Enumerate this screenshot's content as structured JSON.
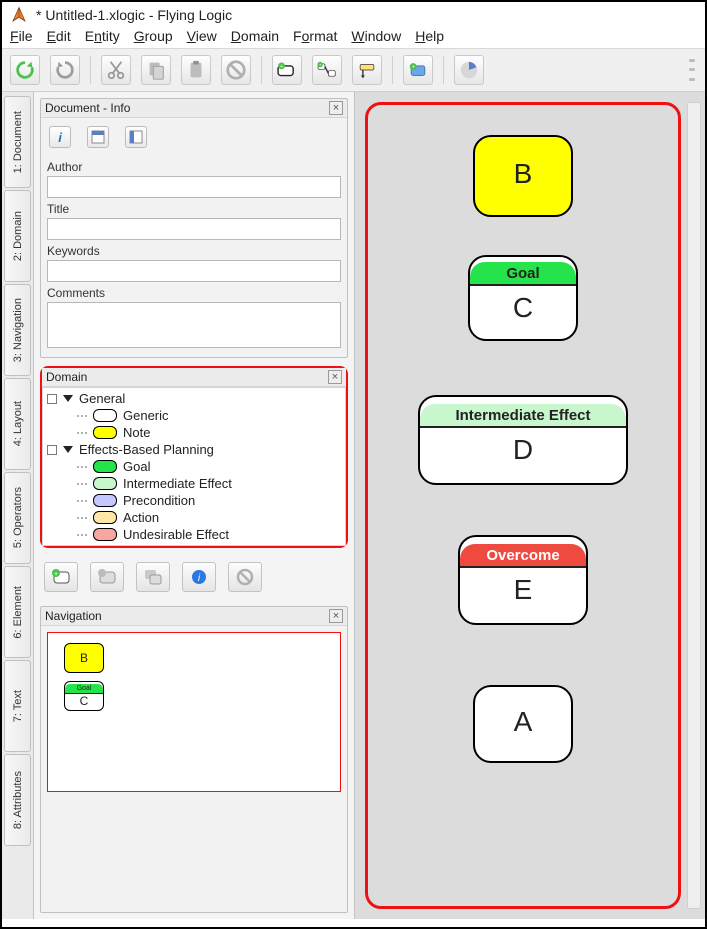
{
  "window": {
    "title": "* Untitled-1.xlogic - Flying Logic"
  },
  "menu": {
    "file": {
      "label": "File",
      "underline": "F"
    },
    "edit": {
      "label": "Edit",
      "underline": "E"
    },
    "entity": {
      "label": "Entity",
      "underline": "n"
    },
    "group": {
      "label": "Group",
      "underline": "G"
    },
    "view": {
      "label": "View",
      "underline": "V"
    },
    "domain": {
      "label": "Domain",
      "underline": "D"
    },
    "format": {
      "label": "Format",
      "underline": "o"
    },
    "window": {
      "label": "Window",
      "underline": "W"
    },
    "help": {
      "label": "Help",
      "underline": "H"
    }
  },
  "toolbar_icons": {
    "refresh": "refresh-icon",
    "redo": "redo-icon",
    "cut": "scissors-icon",
    "copy": "copy-icon",
    "paste": "clipboard-icon",
    "noentry": "noentry-icon",
    "addEntity": "add-entity-icon",
    "addEdge": "add-edge-icon",
    "addAnnotation": "add-annotation-icon",
    "addDomain": "add-domain-icon",
    "pie": "pie-icon"
  },
  "vtabs": [
    {
      "id": "document",
      "label": "1: Document"
    },
    {
      "id": "domain",
      "label": "2: Domain"
    },
    {
      "id": "navigation",
      "label": "3: Navigation"
    },
    {
      "id": "layout",
      "label": "4: Layout"
    },
    {
      "id": "operators",
      "label": "5: Operators"
    },
    {
      "id": "element",
      "label": "6: Element"
    },
    {
      "id": "text",
      "label": "7: Text"
    },
    {
      "id": "attributes",
      "label": "8: Attributes"
    }
  ],
  "docinfo": {
    "title": "Document - Info",
    "tabs": {
      "info": "info-tab-icon",
      "page1": "page-tab-icon",
      "page2": "page-tab-icon"
    },
    "fields": {
      "author": {
        "label": "Author",
        "value": ""
      },
      "title": {
        "label": "Title",
        "value": ""
      },
      "keywords": {
        "label": "Keywords",
        "value": ""
      },
      "comments": {
        "label": "Comments",
        "value": ""
      }
    }
  },
  "domain": {
    "title": "Domain",
    "groups": [
      {
        "name": "General",
        "items": [
          {
            "label": "Generic",
            "color": "#ffffff"
          },
          {
            "label": "Note",
            "color": "#ffff00"
          }
        ]
      },
      {
        "name": "Effects-Based Planning",
        "items": [
          {
            "label": "Goal",
            "color": "#25e34a"
          },
          {
            "label": "Intermediate Effect",
            "color": "#c8f7ce"
          },
          {
            "label": "Precondition",
            "color": "#c4c8ff"
          },
          {
            "label": "Action",
            "color": "#ffe8a6"
          },
          {
            "label": "Undesirable Effect",
            "color": "#f7a6a0"
          }
        ]
      }
    ],
    "buttons": {
      "add": "add-class-icon",
      "remove": "remove-class-icon",
      "dup": "duplicate-icon",
      "info": "info-icon",
      "noentry": "noentry-icon"
    }
  },
  "navigation": {
    "title": "Navigation",
    "mini": [
      {
        "label": "B",
        "hdr": "",
        "bg": "#ffff00"
      },
      {
        "label": "C",
        "hdr": "Goal",
        "hdrbg": "#25e34a",
        "bg": "#ffffff"
      }
    ]
  },
  "canvas": {
    "nodes": {
      "B": {
        "label": "B"
      },
      "C": {
        "header": "Goal",
        "label": "C"
      },
      "D": {
        "header": "Intermediate Effect",
        "label": "D"
      },
      "E": {
        "header": "Overcome",
        "label": "E"
      },
      "A": {
        "label": "A"
      }
    }
  }
}
